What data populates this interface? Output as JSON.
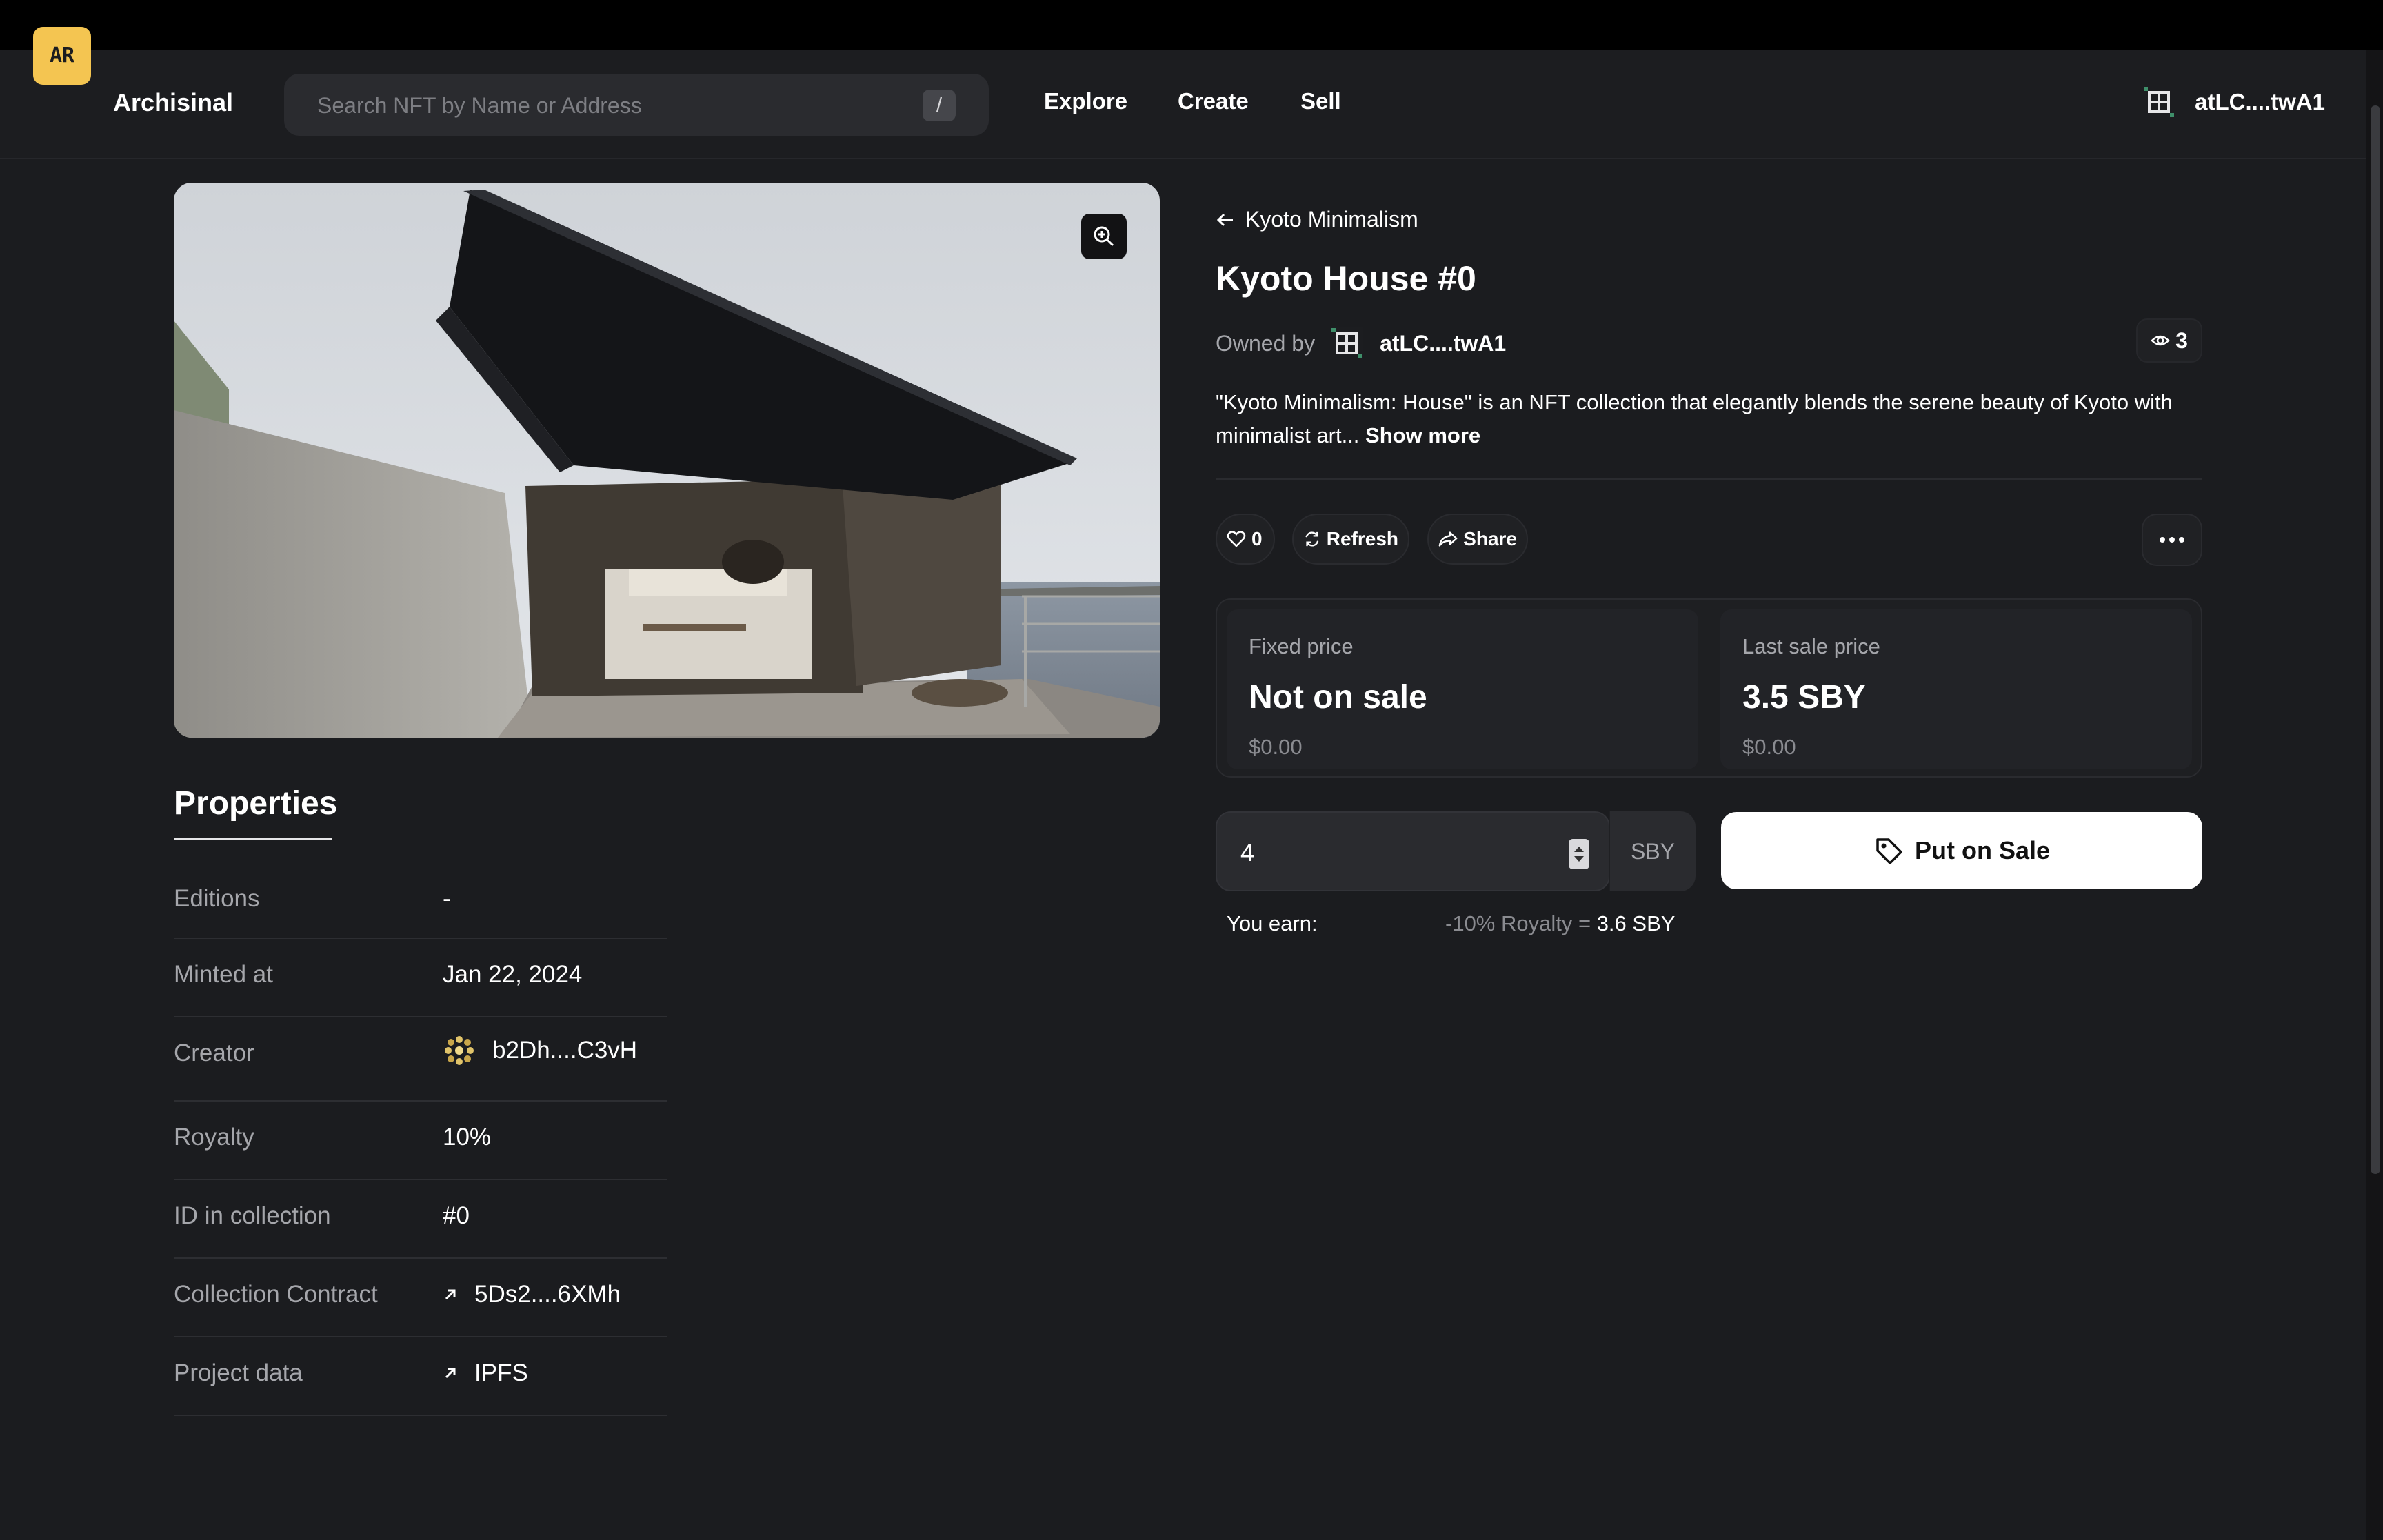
{
  "header": {
    "brand": "Archisinal",
    "logo_text": "AR",
    "search_placeholder": "Search NFT by Name or Address",
    "search_shortcut": "/",
    "nav": [
      "Explore",
      "Create",
      "Sell"
    ],
    "account": "atLC....twA1"
  },
  "nft": {
    "collection": "Kyoto Minimalism",
    "title": "Kyoto House #0",
    "owned_by_label": "Owned by",
    "owner": "atLC....twA1",
    "views": "3",
    "description": "\"Kyoto Minimalism: House\" is an NFT collection that elegantly blends the serene beauty of Kyoto with minimalist art...",
    "show_more": "Show more"
  },
  "actions": {
    "likes": "0",
    "refresh": "Refresh",
    "share": "Share"
  },
  "prices": {
    "fixed_label": "Fixed price",
    "fixed_value": "Not on sale",
    "fixed_usd": "$0.00",
    "last_label": "Last sale price",
    "last_value": "3.5 SBY",
    "last_usd": "$0.00"
  },
  "sale": {
    "amount": "4",
    "currency": "SBY",
    "button": "Put on Sale",
    "earn_label": "You earn:",
    "earn_detail": "-10% Royalty = ",
    "earn_total": "3.6 SBY"
  },
  "properties": {
    "title": "Properties",
    "rows": [
      {
        "label": "Editions",
        "value": "-"
      },
      {
        "label": "Minted at",
        "value": "Jan 22, 2024"
      },
      {
        "label": "Creator",
        "value": "b2Dh....C3vH"
      },
      {
        "label": "Royalty",
        "value": "10%"
      },
      {
        "label": "ID in collection",
        "value": "#0"
      },
      {
        "label": "Collection Contract",
        "value": "5Ds2....6XMh"
      },
      {
        "label": "Project data",
        "value": "IPFS"
      }
    ]
  }
}
